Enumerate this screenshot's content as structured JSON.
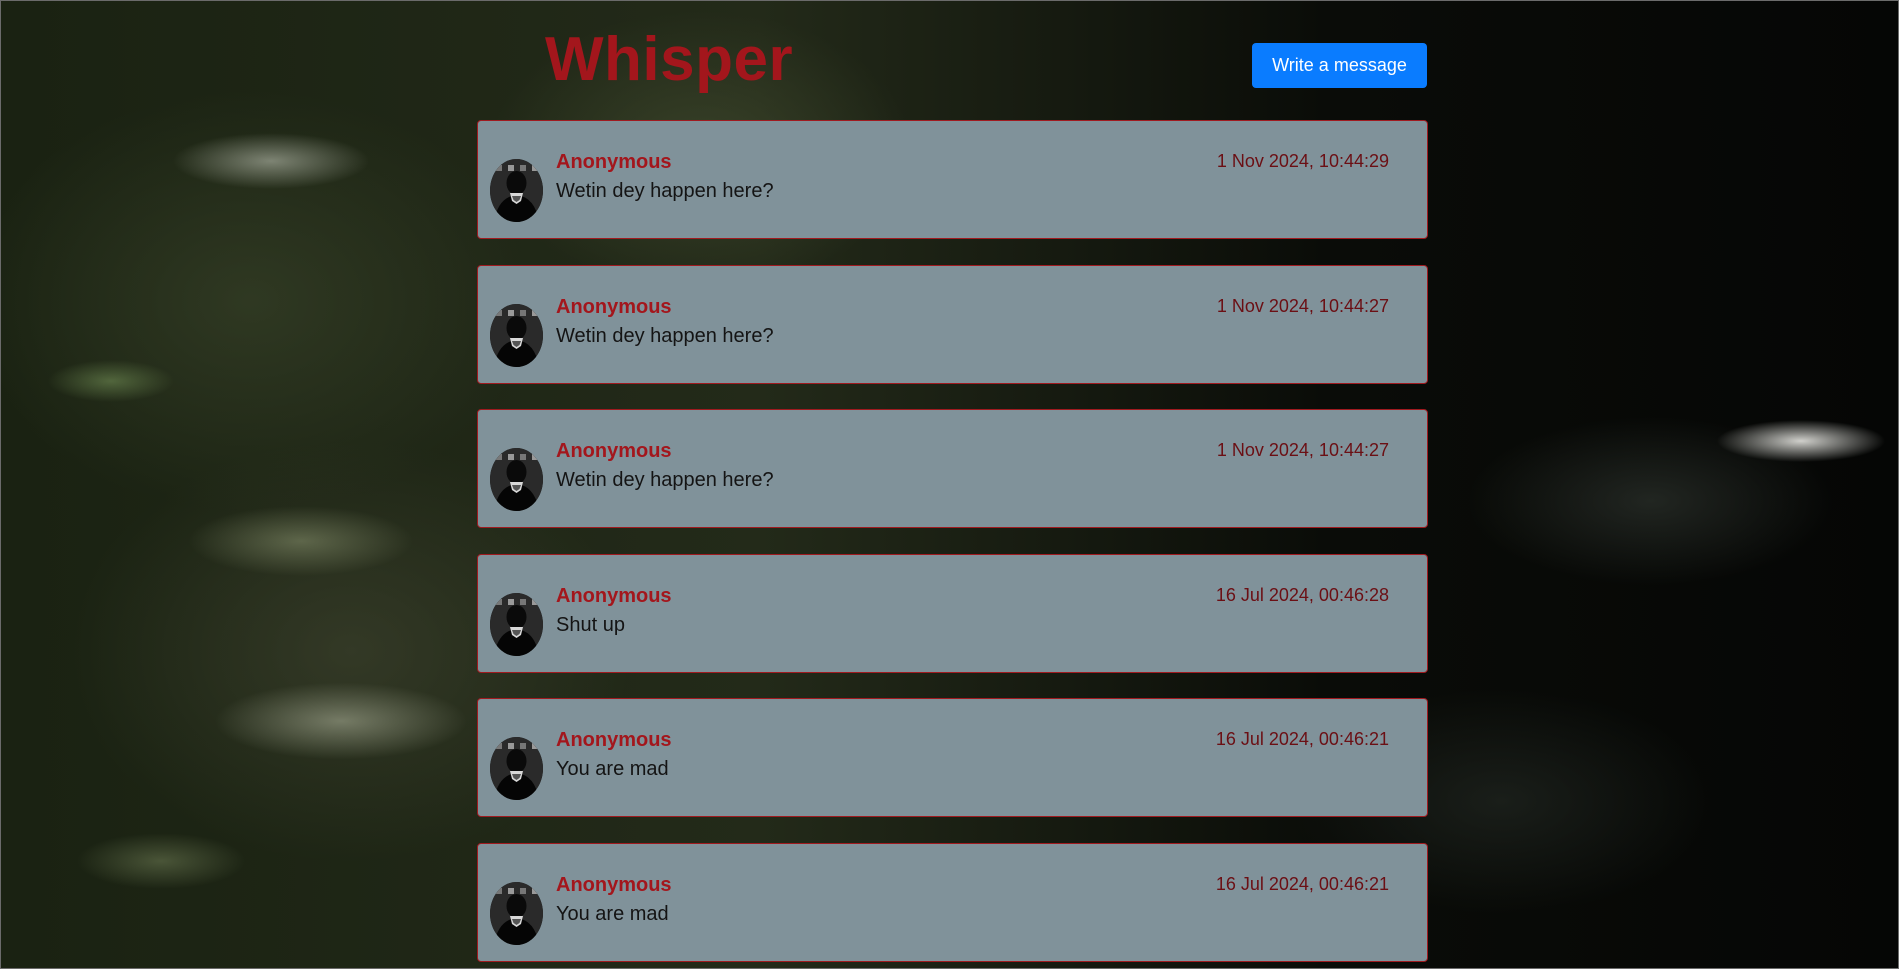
{
  "header": {
    "title": "Whisper",
    "write_button_label": "Write a message"
  },
  "colors": {
    "title": "#a3161c",
    "button": "#0a7cff",
    "card_background": "#80929a",
    "card_border": "#a01a1f",
    "timestamp": "#6b0f14"
  },
  "messages": [
    {
      "author": "Anonymous",
      "timestamp": "1 Nov 2024, 10:44:29",
      "text": "Wetin dey happen here?"
    },
    {
      "author": "Anonymous",
      "timestamp": "1 Nov 2024, 10:44:27",
      "text": "Wetin dey happen here?"
    },
    {
      "author": "Anonymous",
      "timestamp": "1 Nov 2024, 10:44:27",
      "text": "Wetin dey happen here?"
    },
    {
      "author": "Anonymous",
      "timestamp": "16 Jul 2024, 00:46:28",
      "text": "Shut up"
    },
    {
      "author": "Anonymous",
      "timestamp": "16 Jul 2024, 00:46:21",
      "text": "You are mad"
    },
    {
      "author": "Anonymous",
      "timestamp": "16 Jul 2024, 00:46:21",
      "text": "You are mad"
    }
  ]
}
